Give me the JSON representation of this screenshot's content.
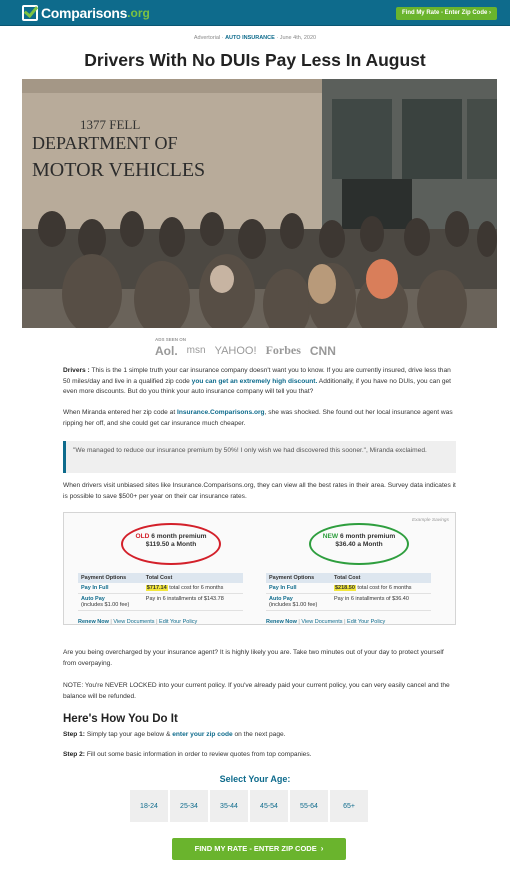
{
  "header": {
    "logo_name": "Comparisons",
    "logo_tld": ".org",
    "cta_label": "Find My Rate - Enter Zip Code",
    "cta_arrow": "›"
  },
  "article": {
    "meta_prefix": "Advertorial ·",
    "meta_category": "AUTO INSURANCE",
    "meta_date": "· June 4th, 2020",
    "title": "Drivers With No DUIs Pay Less In August"
  },
  "seen_on": {
    "label": "ADS SEEN ON",
    "logos": [
      "Aol.",
      "msn",
      "YAHOO!",
      "Forbes",
      "CNN"
    ]
  },
  "body": {
    "p1_lead": "Drivers :",
    "p1_text": " This is the 1 simple truth your car insurance company doesn't want you to know. If you are currently insured, drive less than 50 miles/day and live in a qualified zip code ",
    "p1_link": "you can get an extremely high discount.",
    "p1_tail": " Additionally, if you have no DUIs, you can get even more discounts. But do you think your auto insurance company will tell you that?",
    "p2_a": "When Miranda entered her zip code at ",
    "p2_link": "Insurance.Comparisons.org",
    "p2_b": ", she was shocked. She found out her local insurance agent was ripping her off, and she could get car insurance much cheaper.",
    "quote": "\"We managed to reduce our insurance premium by 50%! I only wish we had discovered this sooner.\", Miranda exclaimed.",
    "p3": "When drivers visit unbiased sites like Insurance.Comparisons.org, they can view all the best rates in their area. Survey data indicates it is possible to save $500+ per year on their car insurance rates.",
    "p4": "Are you being overcharged by your insurance agent? It is highly likely you are. Take two minutes out of your day to protect yourself from overpaying.",
    "p5": "NOTE: You're NEVER LOCKED into your current policy. If you've already paid your current policy, you can very easily cancel and the balance will be refunded.",
    "how_title": "Here's How You Do It",
    "step1_lead": "Step 1:",
    "step1_a": " Simply tap your age below & ",
    "step1_link": "enter your zip code",
    "step1_b": " on the next page.",
    "step2_lead": "Step 2:",
    "step2_text": " Fill out some basic information in order to review quotes from top companies."
  },
  "compare": {
    "example_label": "Example Savings",
    "old": {
      "tag": "OLD",
      "line1": " 6 month premium",
      "line2": "$119.50 a Month",
      "color": "#d3202a",
      "col1": "Payment Options",
      "col2": "Total Cost",
      "row1_label": "Pay In Full",
      "row1_price": "$717.14",
      "row1_text": " total cost for 6 months",
      "row2_label": "Auto Pay",
      "row2_sub": "(includes $1.00 fee)",
      "row2_text": "Pay in 6 installments of $143.78",
      "links": [
        "Renew Now",
        "View Documents",
        "Edit Your Policy"
      ]
    },
    "new": {
      "tag": "NEW",
      "line1": " 6 month premium",
      "line2": "$36.40 a Month",
      "color": "#2e9e3e",
      "col1": "Payment Options",
      "col2": "Total Cost",
      "row1_label": "Pay In Full",
      "row1_price": "$218.50",
      "row1_text": " total cost for 6 months",
      "row2_label": "Auto Pay",
      "row2_sub": "(includes $1.00 fee)",
      "row2_text": "Pay in 6 installments of $36.40",
      "links": [
        "Renew Now",
        "View Documents",
        "Edit Your Policy"
      ]
    }
  },
  "ages": {
    "title": "Select Your Age:",
    "options": [
      "18-24",
      "25-34",
      "35-44",
      "45-54",
      "55-64",
      "65+"
    ]
  },
  "cta": {
    "label": "FIND MY RATE - ENTER ZIP CODE",
    "arrow": "›"
  },
  "hero": {
    "sign_line1": "1377 FELL",
    "sign_line2": "DEPARTMENT OF",
    "sign_line3": "MOTOR VEHICLES"
  },
  "colors": {
    "brand": "#0e6b8c",
    "accent": "#6ab42d"
  }
}
